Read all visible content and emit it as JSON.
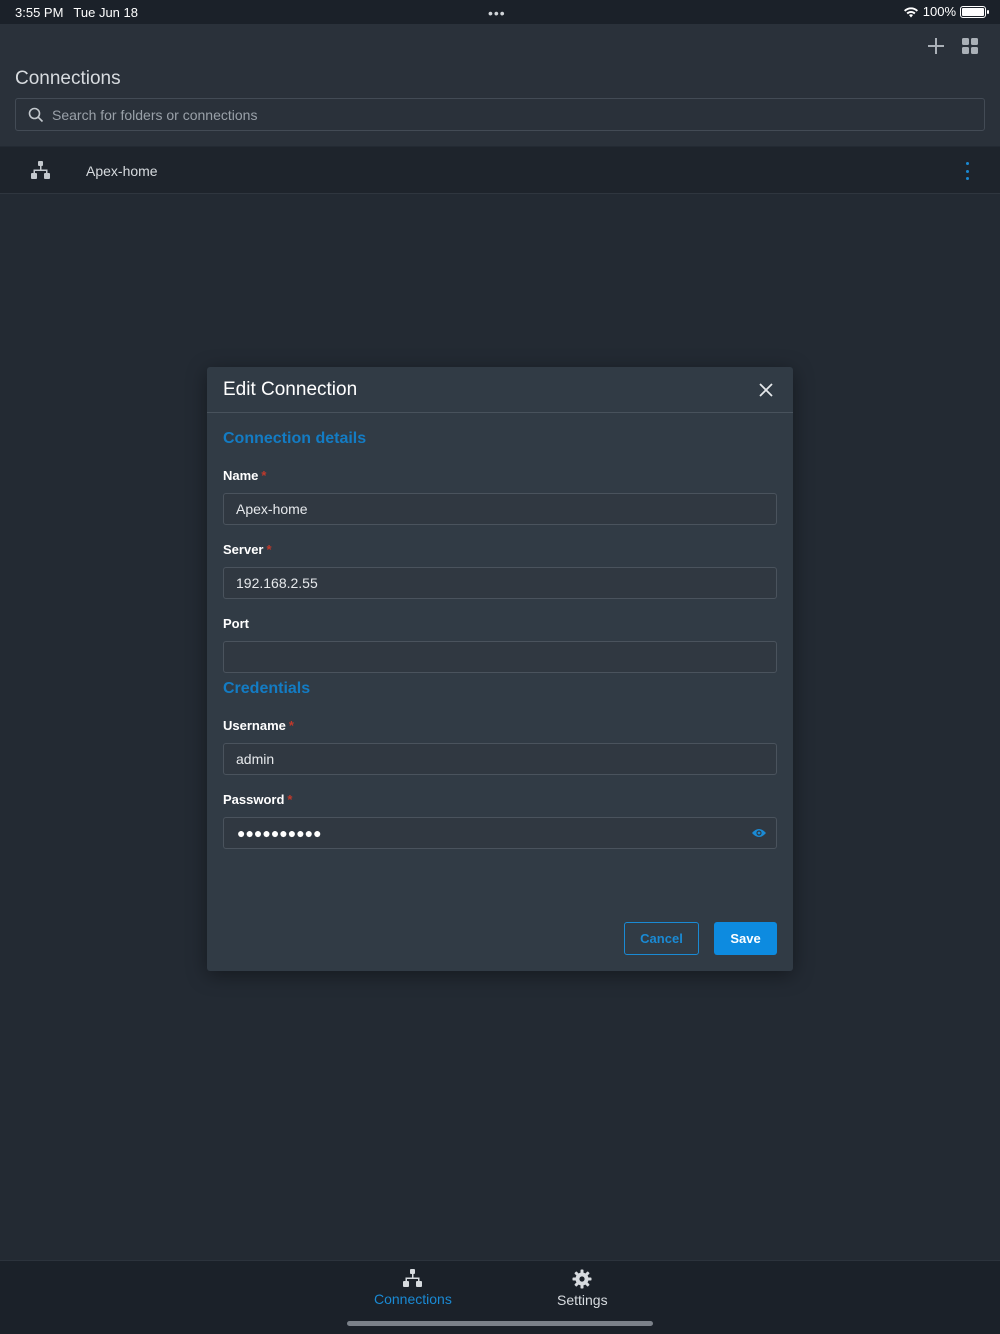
{
  "status_bar": {
    "time": "3:55 PM",
    "date": "Tue Jun 18",
    "battery": "100%",
    "battery_level": 1.0
  },
  "header": {
    "title": "Connections",
    "search_placeholder": "Search for folders or connections"
  },
  "connections": [
    {
      "label": "Apex-home"
    }
  ],
  "modal": {
    "title": "Edit Connection",
    "section_details": "Connection details",
    "name_label": "Name",
    "name_value": "Apex-home",
    "server_label": "Server",
    "server_value": "192.168.2.55",
    "port_label": "Port",
    "port_value": "",
    "section_credentials": "Credentials",
    "username_label": "Username",
    "username_value": "admin",
    "password_label": "Password",
    "password_mask": "●●●●●●●●●●",
    "required_mark": "*",
    "cancel_label": "Cancel",
    "save_label": "Save"
  },
  "tabs": [
    {
      "label": "Connections",
      "active": true
    },
    {
      "label": "Settings",
      "active": false
    }
  ],
  "colors": {
    "accent": "#1a8ad4",
    "save_button": "#0d8be0",
    "required": "#c0392b"
  }
}
